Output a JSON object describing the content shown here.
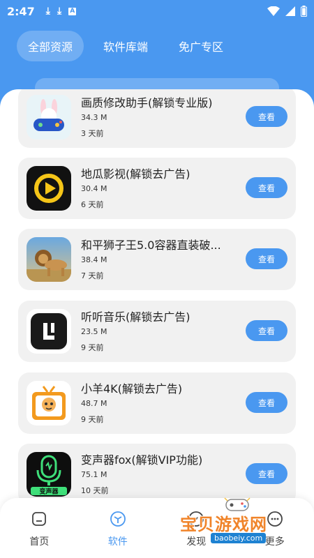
{
  "status_bar": {
    "time": "2:47",
    "notification_a": "A"
  },
  "tabs": [
    {
      "label": "全部资源",
      "active": true
    },
    {
      "label": "软件库端",
      "active": false
    },
    {
      "label": "免广专区",
      "active": false
    }
  ],
  "apps": [
    {
      "title": "画质修改助手(解锁专业版)",
      "size": "34.3 M",
      "time": "3 天前",
      "button": "查看",
      "icon": "gamepad-bunny-icon"
    },
    {
      "title": "地瓜影视(解锁去广告)",
      "size": "30.4 M",
      "time": "6 天前",
      "button": "查看",
      "icon": "play-circle-icon"
    },
    {
      "title": "和平狮子王5.0容器直装破...",
      "size": "38.4 M",
      "time": "7 天前",
      "button": "查看",
      "icon": "lion-icon"
    },
    {
      "title": "听听音乐(解锁去广告)",
      "size": "23.5 M",
      "time": "9 天前",
      "button": "查看",
      "icon": "music-app-icon"
    },
    {
      "title": "小羊4K(解锁去广告)",
      "size": "48.7 M",
      "time": "9 天前",
      "button": "查看",
      "icon": "tv-sheep-icon"
    },
    {
      "title": "变声器fox(解锁VIP功能)",
      "size": "75.1 M",
      "time": "10 天前",
      "button": "查看",
      "icon": "voice-changer-icon",
      "icon_text": "变声器"
    }
  ],
  "bottom_nav": [
    {
      "label": "首页",
      "icon": "home-icon",
      "active": false
    },
    {
      "label": "软件",
      "icon": "cube-icon",
      "active": true
    },
    {
      "label": "发现",
      "icon": "compass-icon",
      "active": false
    },
    {
      "label": "更多",
      "icon": "more-icon",
      "active": false
    }
  ],
  "watermark": {
    "text": "宝贝游戏网",
    "url": "baobeiy.com"
  },
  "colors": {
    "primary": "#4a98f0",
    "card_bg": "#f1f1f1",
    "watermark": "#f0842a"
  }
}
